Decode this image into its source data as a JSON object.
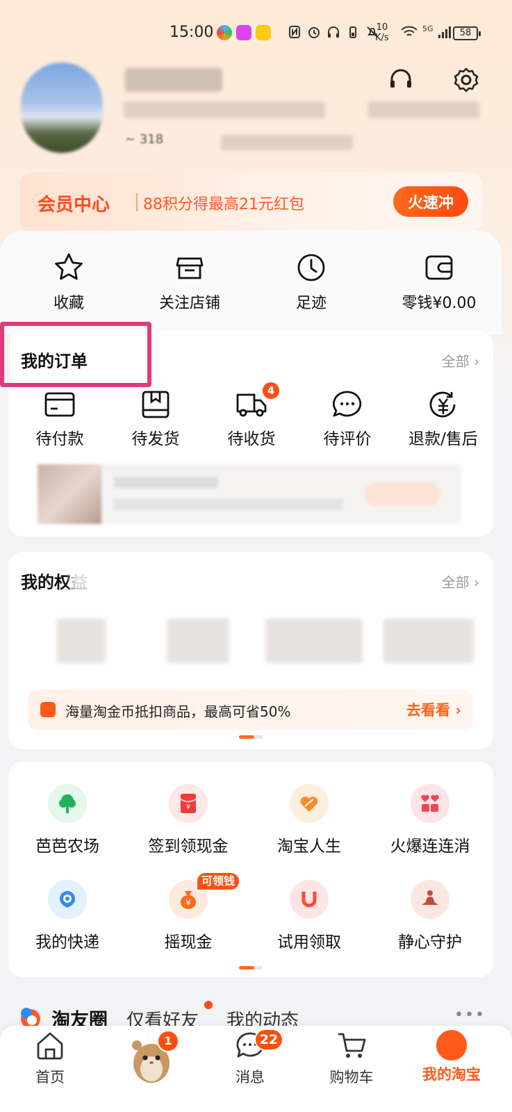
{
  "status_bar": {
    "time": "15:00",
    "speed_value": "10",
    "speed_unit": "K/s",
    "network": "5G",
    "battery": "58"
  },
  "header": {
    "partial_text": "318"
  },
  "member": {
    "title": "会员中心",
    "text": "88积分得最高21元红包",
    "button": "火速冲"
  },
  "quick": [
    {
      "label": "收藏",
      "icon": "star-icon"
    },
    {
      "label": "关注店铺",
      "icon": "store-icon"
    },
    {
      "label": "足迹",
      "icon": "clock-icon"
    },
    {
      "label": "零钱¥0.00",
      "icon": "wallet-icon"
    }
  ],
  "orders": {
    "title": "我的订单",
    "all": "全部 ›",
    "items": [
      {
        "label": "待付款",
        "icon": "card-icon"
      },
      {
        "label": "待发货",
        "icon": "box-icon"
      },
      {
        "label": "待收货",
        "icon": "truck-icon",
        "badge": "4"
      },
      {
        "label": "待评价",
        "icon": "chat-icon"
      },
      {
        "label": "退款/售后",
        "icon": "refund-icon"
      }
    ]
  },
  "rights": {
    "title": "我的权益",
    "all": "全部 ›",
    "promo_text": "海量淘金币抵扣商品，最高可省50%",
    "promo_link": "去看看 ›"
  },
  "apps": [
    {
      "label": "芭芭农场",
      "icon": "tree-icon",
      "bg": "#e5f6ea",
      "fg": "#22b05a"
    },
    {
      "label": "签到领现金",
      "icon": "redpacket-icon",
      "bg": "#fde7e7",
      "fg": "#ee3b3b"
    },
    {
      "label": "淘宝人生",
      "icon": "heart-tag-icon",
      "bg": "#fdeedd",
      "fg": "#ff8a2a"
    },
    {
      "label": "火爆连连消",
      "icon": "blocks-icon",
      "bg": "#fde4e6",
      "fg": "#f04456"
    },
    {
      "label": "我的快递",
      "icon": "courier-icon",
      "bg": "#e3f0fd",
      "fg": "#2f8bf0"
    },
    {
      "label": "摇现金",
      "icon": "money-bag-icon",
      "bg": "#fdeadd",
      "fg": "#ff6a1a",
      "tag": "可领钱"
    },
    {
      "label": "试用领取",
      "icon": "magnet-icon",
      "bg": "#fde5e3",
      "fg": "#ff4a3a"
    },
    {
      "label": "静心守护",
      "icon": "meditate-icon",
      "bg": "#fbe7e2",
      "fg": "#c24a3a"
    }
  ],
  "friends": {
    "title": "淘友圈",
    "tab_friends": "仅看好友",
    "tab_mine": "我的动态",
    "more": "•••"
  },
  "tabbar": [
    {
      "label": "首页",
      "icon": "home-icon"
    },
    {
      "label": "",
      "icon": "hamster-icon",
      "badge": "1"
    },
    {
      "label": "消息",
      "icon": "message-icon",
      "badge": "22"
    },
    {
      "label": "购物车",
      "icon": "cart-icon"
    },
    {
      "label": "我的淘宝",
      "icon": "taobao-icon"
    }
  ],
  "colors": {
    "accent": "#ff5a1a",
    "highlight": "#e03a7a"
  }
}
